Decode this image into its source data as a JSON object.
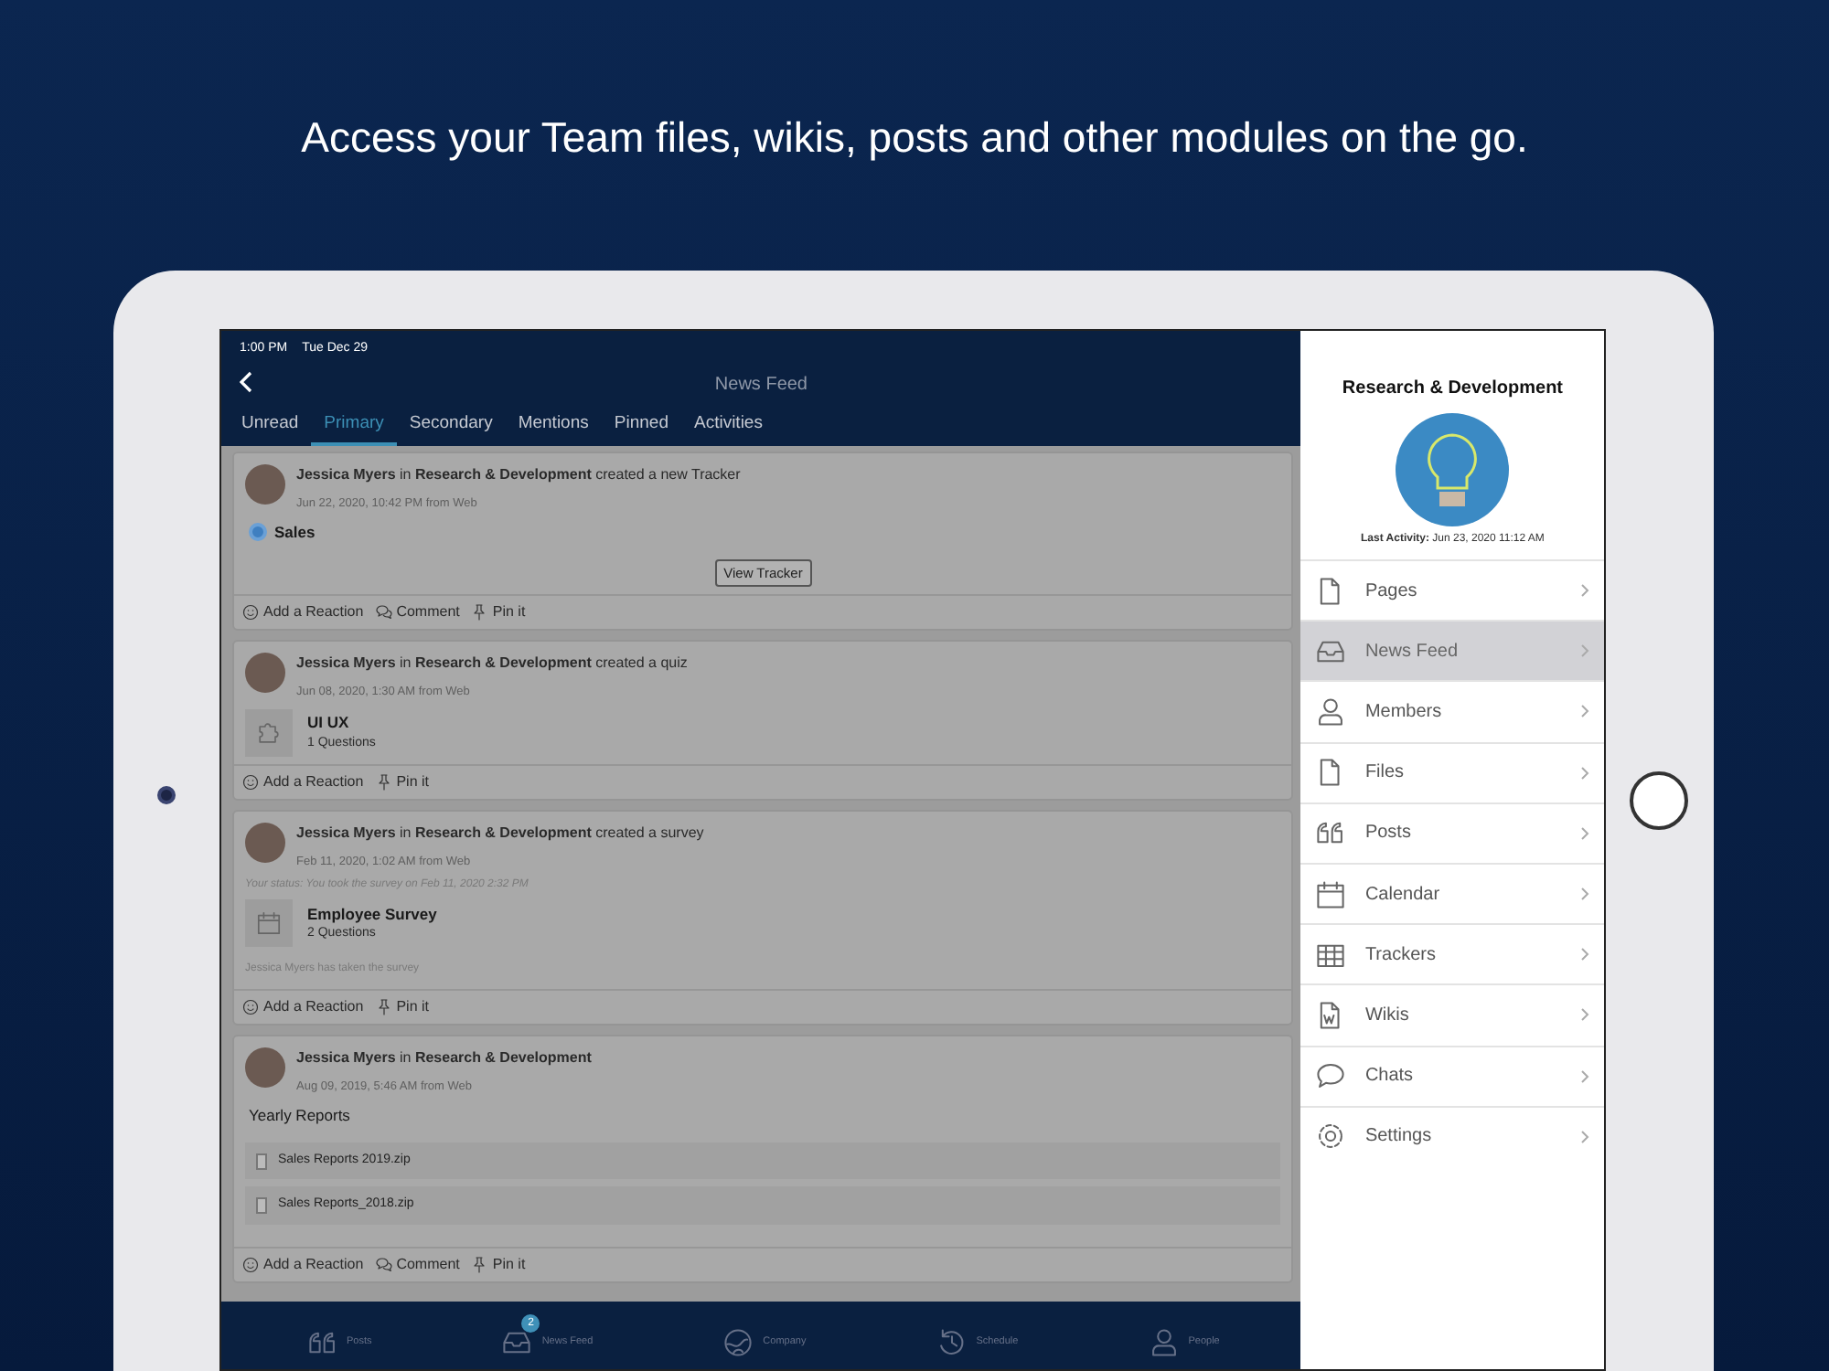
{
  "headline": "Access your Team files, wikis, posts and other modules on the go.",
  "status_bar": {
    "time": "1:00 PM",
    "date": "Tue Dec 29"
  },
  "nav": {
    "title": "News Feed"
  },
  "tabs": [
    {
      "label": "Unread",
      "selected": false
    },
    {
      "label": "Primary",
      "selected": true
    },
    {
      "label": "Secondary",
      "selected": false
    },
    {
      "label": "Mentions",
      "selected": false
    },
    {
      "label": "Pinned",
      "selected": false
    },
    {
      "label": "Activities",
      "selected": false
    }
  ],
  "posts": [
    {
      "kind": "tracker",
      "text": "**Jessica Myers** in **Research & Development** created a new Tracker",
      "timestamp": "Jun 22, 2020, 10:42 PM from Web",
      "item": "Sales",
      "button": "View Tracker",
      "actions": [
        {
          "kind": "reaction",
          "label": "Add a Reaction"
        },
        {
          "kind": "comment",
          "label": "Comment"
        },
        {
          "kind": "pin",
          "label": "Pin it"
        }
      ]
    },
    {
      "kind": "quiz",
      "text": "**Jessica Myers** in **Research & Development** created a quiz",
      "timestamp": "Jun 08, 2020, 1:30 AM from Web",
      "item": "UI UX",
      "subtitle": "1 Questions",
      "actions": [
        {
          "kind": "reaction",
          "label": "Add a Reaction"
        },
        {
          "kind": "pin",
          "label": "Pin it"
        }
      ]
    },
    {
      "kind": "survey",
      "text": "**Jessica Myers** in **Research & Development** created a survey",
      "timestamp": "Feb 11, 2020, 1:02 AM from Web",
      "status": "Your status: You took the survey on Feb 11, 2020 2:32 PM",
      "item": "Employee Survey",
      "subtitle": "2 Questions",
      "note": "Jessica Myers has taken the survey",
      "actions": [
        {
          "kind": "reaction",
          "label": "Add a Reaction"
        },
        {
          "kind": "pin",
          "label": "Pin it"
        }
      ]
    },
    {
      "kind": "files",
      "text": "**Jessica Myers** in **Research & Development**",
      "timestamp": "Aug 09, 2019, 5:46 AM from Web",
      "message": "Yearly Reports",
      "files": [
        "Sales Reports 2019.zip",
        "Sales Reports_2018.zip"
      ],
      "actions": [
        {
          "kind": "reaction",
          "label": "Add a Reaction"
        },
        {
          "kind": "comment",
          "label": "Comment"
        },
        {
          "kind": "pin",
          "label": "Pin it"
        }
      ]
    }
  ],
  "bottom_tabs": [
    {
      "kind": "posts",
      "label": "Posts"
    },
    {
      "kind": "feed",
      "label": "News Feed",
      "badge": "2"
    },
    {
      "kind": "company",
      "label": "Company"
    },
    {
      "kind": "schedule",
      "label": "Schedule"
    },
    {
      "kind": "people",
      "label": "People"
    }
  ],
  "panel": {
    "title": "Research & Development",
    "last_activity": "**Last Activity:** Jun 23, 2020 11:12 AM",
    "items": [
      {
        "kind": "pages",
        "label": "Pages",
        "selected": false
      },
      {
        "kind": "feed",
        "label": "News Feed",
        "selected": true
      },
      {
        "kind": "members",
        "label": "Members",
        "selected": false
      },
      {
        "kind": "files",
        "label": "Files",
        "selected": false
      },
      {
        "kind": "posts",
        "label": "Posts",
        "selected": false
      },
      {
        "kind": "calendar",
        "label": "Calendar",
        "selected": false
      },
      {
        "kind": "trackers",
        "label": "Trackers",
        "selected": false
      },
      {
        "kind": "wikis",
        "label": "Wikis",
        "selected": false
      },
      {
        "kind": "chats",
        "label": "Chats",
        "selected": false
      },
      {
        "kind": "settings",
        "label": "Settings",
        "selected": false
      }
    ]
  }
}
